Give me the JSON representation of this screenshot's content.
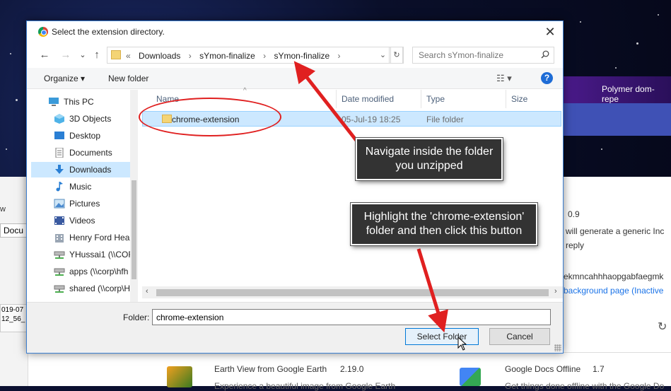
{
  "background": {
    "left_tab": "Docu",
    "left_w": "w",
    "left_thumb_lines": [
      "019-07",
      "12_56_"
    ],
    "polymer_label": "Polymer dom-repe",
    "right_texts": {
      "version_top": "0.9",
      "desc_line1": "will generate a generic Inc",
      "desc_line2": "reply",
      "ext_id": "ekmncahhhaopgabfaegmk",
      "bg_page_link": "background page (Inactive"
    },
    "earth_title": "Earth View from Google Earth",
    "earth_version": "2.19.0",
    "earth_desc": "Experience a beautiful image from Google Earth",
    "docs_title": "Google Docs Offline",
    "docs_version": "1.7",
    "docs_desc": "Get things done offline with the Google Do"
  },
  "dialog": {
    "title": "Select the extension directory.",
    "breadcrumb_prefix": "«",
    "breadcrumbs": [
      "Downloads",
      "sYmon-finalize",
      "sYmon-finalize"
    ],
    "search_placeholder": "Search sYmon-finalize",
    "toolbar": {
      "organize_label": "Organize ▾",
      "new_folder_label": "New folder"
    },
    "nav_items": [
      {
        "label": "This PC",
        "icon": "pc-icon"
      },
      {
        "label": "3D Objects",
        "icon": "cube-icon"
      },
      {
        "label": "Desktop",
        "icon": "desktop-icon"
      },
      {
        "label": "Documents",
        "icon": "documents-icon"
      },
      {
        "label": "Downloads",
        "icon": "download-arrow-icon"
      },
      {
        "label": "Music",
        "icon": "music-note-icon"
      },
      {
        "label": "Pictures",
        "icon": "pictures-icon"
      },
      {
        "label": "Videos",
        "icon": "videos-icon"
      },
      {
        "label": "Henry Ford Heal",
        "icon": "building-icon"
      },
      {
        "label": "YHussai1 (\\\\COF",
        "icon": "network-drive-icon"
      },
      {
        "label": "apps (\\\\corp\\hfh",
        "icon": "network-drive-icon"
      },
      {
        "label": "shared (\\\\corp\\H",
        "icon": "network-drive-icon"
      }
    ],
    "columns": {
      "name": "Name",
      "date": "Date modified",
      "type": "Type",
      "size": "Size"
    },
    "file": {
      "name": "chrome-extension",
      "date": "05-Jul-19 18:25",
      "type": "File folder"
    },
    "folder_label": "Folder:",
    "folder_value": "chrome-extension",
    "select_button": "Select Folder",
    "cancel_button": "Cancel"
  },
  "callouts": {
    "navigate_line1": "Navigate inside the folder",
    "navigate_line2": "you unzipped",
    "highlight_line1": "Highlight the 'chrome-extension'",
    "highlight_line2": "folder and then click this button"
  },
  "colors": {
    "annotation_red": "#e02020",
    "selection_blue": "#cce8ff",
    "accent_blue": "#0078d7"
  }
}
